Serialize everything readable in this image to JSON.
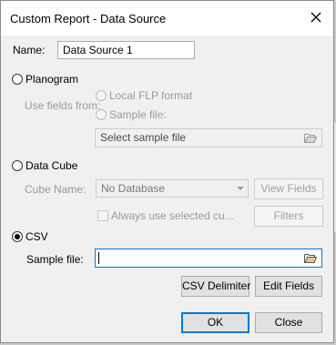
{
  "title": "Custom Report - Data Source",
  "name": {
    "label": "Name:",
    "value": "Data Source 1"
  },
  "planogram": {
    "label": "Planogram",
    "use_fields_label": "Use fields from:",
    "local_flp": "Local FLP format",
    "sample_file": "Sample file:",
    "sample_file_placeholder": "Select sample file"
  },
  "data_cube": {
    "label": "Data Cube",
    "cube_name_label": "Cube Name:",
    "cube_name_value": "No Database",
    "view_fields": "View Fields",
    "always_use": "Always use selected cu...",
    "filters": "Filters"
  },
  "csv": {
    "label": "CSV",
    "sample_file_label": "Sample file:",
    "sample_file_value": "",
    "csv_delimiter": "CSV Delimiter",
    "edit_fields": "Edit Fields"
  },
  "buttons": {
    "ok": "OK",
    "close": "Close"
  },
  "icons": {
    "close": "close-icon",
    "folder": "folder-open-icon",
    "dropdown": "chevron-down-icon"
  },
  "colors": {
    "focus": "#0078d7",
    "dialog_bg": "#f0f0f0"
  }
}
